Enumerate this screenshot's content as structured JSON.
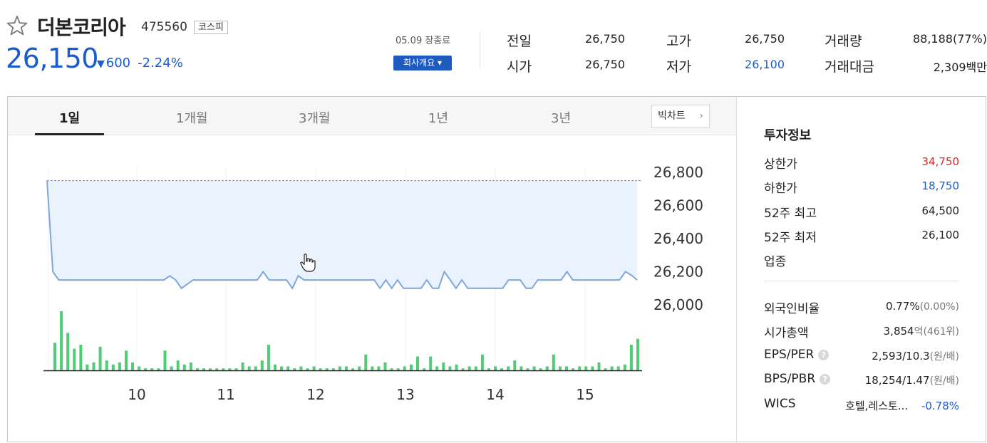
{
  "stock": {
    "name": "더본코리아",
    "code": "475560",
    "market": "코스피",
    "price": "26,150",
    "change_arrow": "▼",
    "change": "600",
    "change_pct": "-2.24%",
    "close_date": "05.09 장종료",
    "company_button": "회사개요 ▾"
  },
  "stats": {
    "prev_close_label": "전일",
    "prev_close": "26,750",
    "open_label": "시가",
    "open": "26,750",
    "high_label": "고가",
    "high": "26,750",
    "low_label": "저가",
    "low": "26,100",
    "volume_label": "거래량",
    "volume": "88,188(77%)",
    "amount_label": "거래대금",
    "amount": "2,309백만"
  },
  "tabs": [
    "1일",
    "1개월",
    "3개월",
    "1년",
    "3년"
  ],
  "active_tab": "1일",
  "bigchart_label": "빅차트",
  "bigchart_chevron": "›",
  "info": {
    "title": "투자정보",
    "upper_limit_label": "상한가",
    "upper_limit": "34,750",
    "lower_limit_label": "하한가",
    "lower_limit": "18,750",
    "high52_label": "52주 최고",
    "high52": "64,500",
    "low52_label": "52주 최저",
    "low52": "26,100",
    "sector_label": "업종",
    "foreign_label": "외국인비율",
    "foreign": "0.77%",
    "foreign_sub": "(0.00%)",
    "mktcap_label": "시가총액",
    "mktcap": "3,854",
    "mktcap_sub": "억(461위)",
    "eps_label": "EPS/PER",
    "eps": "2,593/10.3",
    "eps_sub": "(원/배)",
    "bps_label": "BPS/PBR",
    "bps": "18,254/1.47",
    "bps_sub": "(원/배)",
    "help_glyph": "?",
    "wics_label": "WICS",
    "wics": "호텔,레스토...",
    "wics_change": "-0.78%"
  },
  "colors": {
    "down_blue": "#1a5ccf",
    "up_red": "#e02828",
    "line": "#7ea6dc",
    "fill": "#eaf2fd",
    "volume": "#4fcc74",
    "prev_close_line": "#888888"
  },
  "icons": {
    "favorite": "star-outline-icon",
    "cursor": "hand-pointer-icon"
  },
  "chart_data": {
    "type": "line",
    "x_ticks": [
      "10",
      "11",
      "12",
      "13",
      "14",
      "15"
    ],
    "y_ticks": [
      "26,800",
      "26,600",
      "26,400",
      "26,200",
      "26,000"
    ],
    "ylim": [
      26000,
      26800
    ],
    "reference_line": 26750,
    "series": [
      {
        "values": [
          26750,
          26200,
          26150,
          26150,
          26150,
          26150,
          26150,
          26150,
          26150,
          26150,
          26150,
          26150,
          26150,
          26150,
          26150,
          26150,
          26150,
          26150,
          26150,
          26150,
          26150,
          26175,
          26150,
          26100,
          26125,
          26150,
          26150,
          26150,
          26150,
          26150,
          26150,
          26150,
          26150,
          26150,
          26150,
          26150,
          26150,
          26200,
          26150,
          26150,
          26150,
          26150,
          26100,
          26175,
          26150,
          26150,
          26150,
          26150,
          26150,
          26150,
          26150,
          26150,
          26150,
          26150,
          26150,
          26150,
          26150,
          26100,
          26150,
          26100,
          26150,
          26100,
          26100,
          26100,
          26100,
          26150,
          26100,
          26100,
          26200,
          26150,
          26100,
          26150,
          26100,
          26100,
          26100,
          26100,
          26100,
          26100,
          26100,
          26150,
          26150,
          26150,
          26100,
          26100,
          26150,
          26150,
          26150,
          26150,
          26150,
          26200,
          26150,
          26150,
          26150,
          26150,
          26150,
          26150,
          26150,
          26150,
          26150,
          26200,
          26180,
          26150
        ]
      }
    ],
    "volume": [
      14,
      30,
      19,
      11,
      13,
      3,
      4,
      12,
      5,
      3,
      4,
      10,
      4,
      2,
      1,
      1,
      1,
      10,
      2,
      5,
      3,
      4,
      1,
      1,
      1,
      1,
      1,
      1,
      1,
      4,
      2,
      2,
      5,
      13,
      3,
      2,
      2,
      1,
      2,
      1,
      2,
      1,
      1,
      1,
      2,
      2,
      1,
      2,
      8,
      2,
      2,
      4,
      1,
      1,
      2,
      3,
      7,
      1,
      7,
      2,
      4,
      2,
      3,
      1,
      2,
      2,
      8,
      1,
      2,
      1,
      2,
      5,
      2,
      1,
      2,
      1,
      2,
      8,
      2,
      2,
      1,
      2,
      2,
      2,
      4,
      1,
      2,
      2,
      3,
      13,
      16
    ]
  }
}
